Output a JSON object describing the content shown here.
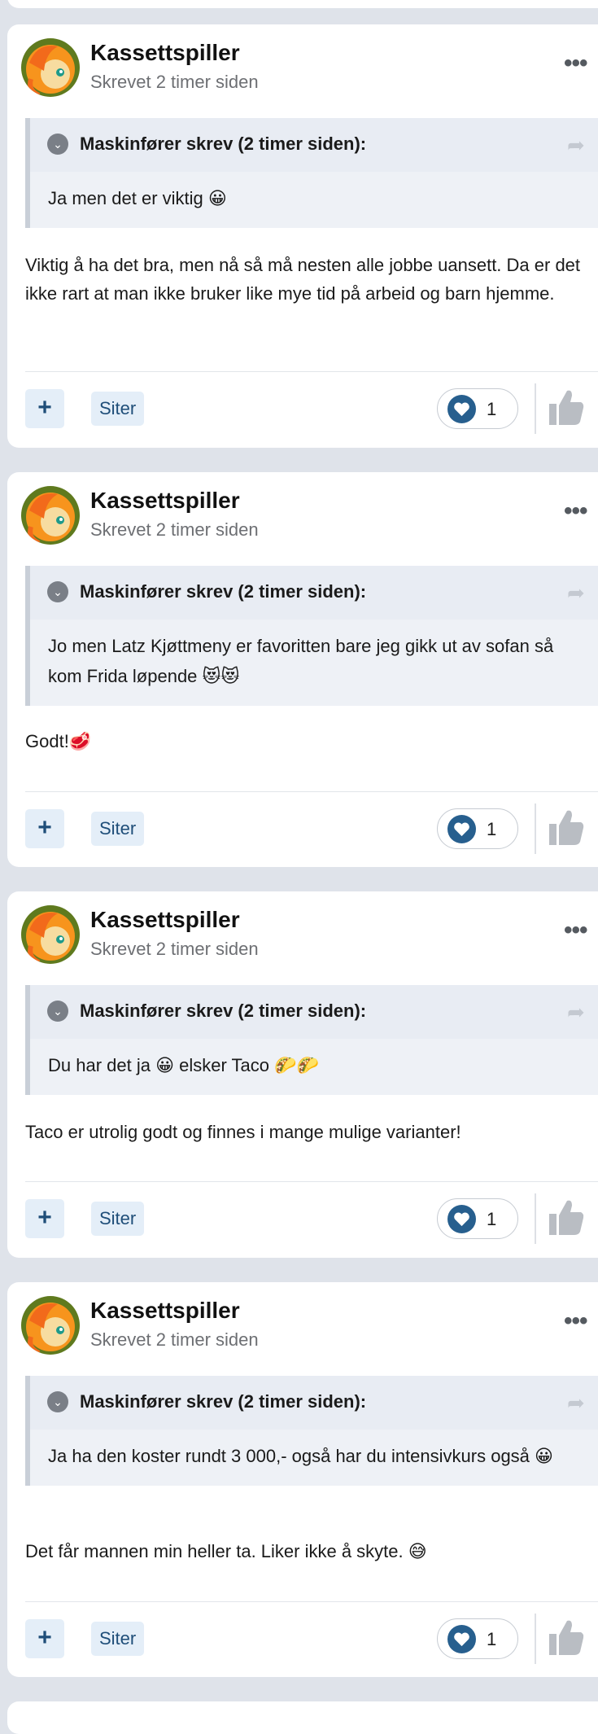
{
  "theme": {
    "accent": "#1f4e79",
    "heart": "#275f8e",
    "page_bg": "#dfe3ea"
  },
  "posts": [
    {
      "author": "Kassettspiller",
      "meta": "Skrevet 2 timer siden",
      "quote_author": "Maskinfører skrev (2 timer siden):",
      "quote_text": "Ja men det er viktig 😀",
      "text": "Viktig å ha det bra, men nå så må nesten alle jobbe uansett. Da er det ikke rart at man ikke bruker like mye tid på arbeid og barn hjemme.",
      "quote_label": "Siter",
      "reaction_count": "1"
    },
    {
      "author": "Kassettspiller",
      "meta": "Skrevet 2 timer siden",
      "quote_author": "Maskinfører skrev (2 timer siden):",
      "quote_text": "Jo men Latz Kjøttmeny er favoritten bare jeg gikk ut av sofan så kom Frida løpende 😻😻",
      "text": "Godt!🥩",
      "quote_label": "Siter",
      "reaction_count": "1"
    },
    {
      "author": "Kassettspiller",
      "meta": "Skrevet 2 timer siden",
      "quote_author": "Maskinfører skrev (2 timer siden):",
      "quote_text": "Du har det ja 😀 elsker Taco 🌮🌮",
      "text": "Taco er utrolig godt og finnes i mange mulige varianter!",
      "quote_label": "Siter",
      "reaction_count": "1"
    },
    {
      "author": "Kassettspiller",
      "meta": "Skrevet 2 timer siden",
      "quote_author": "Maskinfører skrev (2 timer siden):",
      "quote_text": "Ja ha den koster rundt 3 000,- også har du intensivkurs også 😀",
      "text": "Det får mannen min heller ta. Liker ikke å skyte. 😅",
      "quote_label": "Siter",
      "reaction_count": "1"
    }
  ],
  "icons": {
    "more": "more-options-icon",
    "collapse": "chevron-down-icon",
    "share": "share-arrow-icon",
    "add": "plus-icon",
    "reaction": "heart-icon",
    "like": "thumbs-up-icon"
  }
}
